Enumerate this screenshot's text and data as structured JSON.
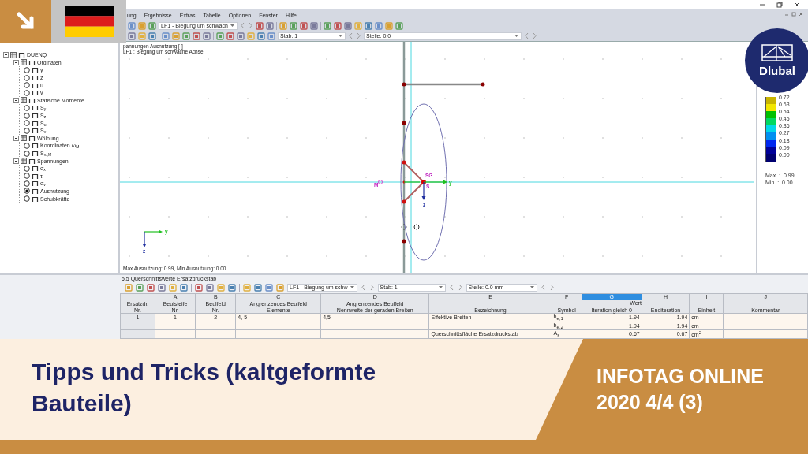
{
  "menu": [
    "ung",
    "Ergebnisse",
    "Extras",
    "Tabelle",
    "Optionen",
    "Fenster",
    "Hilfe"
  ],
  "toolbar": {
    "load_case": "LF1 - Biegung um schwach",
    "member": "Stab: 1",
    "location": "Stelle: 0.0"
  },
  "tree": {
    "label": "DUENQ",
    "expanded": true,
    "children": [
      {
        "label": "Ordinaten",
        "expanded": true,
        "children": [
          {
            "label": "y",
            "selected": false
          },
          {
            "label": "z",
            "selected": false
          },
          {
            "label": "u",
            "selected": false
          },
          {
            "label": "v",
            "selected": false
          }
        ]
      },
      {
        "label": "Statische Momente",
        "expanded": true,
        "children": [
          {
            "label": "S$_{y}$",
            "selected": false
          },
          {
            "label": "S$_{z}$",
            "selected": false
          },
          {
            "label": "S$_{u}$",
            "selected": false
          },
          {
            "label": "S$_{v}$",
            "selected": false
          }
        ]
      },
      {
        "label": "Wölbung",
        "expanded": true,
        "children": [
          {
            "label": "Koordinaten ω$_{M}$",
            "selected": false
          },
          {
            "label": "S$_{ω,M}$",
            "selected": false
          }
        ]
      },
      {
        "label": "Spannungen",
        "expanded": true,
        "children": [
          {
            "label": "σ$_{x}$",
            "selected": false
          },
          {
            "label": "τ",
            "selected": false
          },
          {
            "label": "σ$_{v}$",
            "selected": false
          },
          {
            "label": "Ausnutzung",
            "selected": true
          },
          {
            "label": "Schubkräfte",
            "selected": false
          }
        ]
      }
    ]
  },
  "canvas": {
    "title": "pannungen Ausnutzung [-]",
    "subtitle": "LF1 : Biegung um schwache Achse",
    "labels": [
      "SG",
      "S",
      "M",
      "y",
      "z",
      "y",
      "z"
    ],
    "footer": "Max Ausnutzung: 0.99, Min Ausnutzung: 0.00"
  },
  "legend": {
    "scale": [
      {
        "label": "0.72",
        "color": "#c8b400"
      },
      {
        "label": "0.63",
        "color": "#f2e600"
      },
      {
        "label": "0.54",
        "color": "#00c000"
      },
      {
        "label": "0.45",
        "color": "#00d860"
      },
      {
        "label": "0.36",
        "color": "#00d8e8"
      },
      {
        "label": "0.27",
        "color": "#0090f0"
      },
      {
        "label": "0.18",
        "color": "#0028f0"
      },
      {
        "label": "0.09",
        "color": "#000099"
      },
      {
        "label": "0.00",
        "color": "#000070"
      }
    ],
    "max": "Max  :  0.99",
    "min": "Min  :  0.00"
  },
  "table_panel": {
    "title": "5.5 Querschnittswerte Ersatzdruckstab",
    "load_case": "LF1 - Biegung um schw",
    "member": "Stab: 1",
    "location": "Stelle: 0.0 mm",
    "row_header": [
      "Ersatzdr.",
      "Nr."
    ],
    "group_heading": "Wert",
    "columns": [
      {
        "letter": "A",
        "heading": [
          "Beulsteife",
          "Nr."
        ],
        "selected": false
      },
      {
        "letter": "B",
        "heading": [
          "Beulfeld",
          "Nr."
        ],
        "selected": false
      },
      {
        "letter": "C",
        "heading": [
          "Angrenzendes Beulfeld",
          "Elemente"
        ],
        "selected": false
      },
      {
        "letter": "D",
        "heading": [
          "Angrenzendes Beulfeld",
          "Nennweite der geraden Breiten"
        ],
        "selected": false
      },
      {
        "letter": "E",
        "heading": [
          "Bezeichnung"
        ],
        "selected": false
      },
      {
        "letter": "F",
        "heading": [
          "Symbol"
        ],
        "selected": false
      },
      {
        "letter": "G",
        "heading": [
          "Iteration gleich 0"
        ],
        "selected": true
      },
      {
        "letter": "H",
        "heading": [
          "Enditeration"
        ],
        "selected": false
      },
      {
        "letter": "I",
        "heading": [
          "Einheit"
        ],
        "selected": false
      },
      {
        "letter": "J",
        "heading": [
          "Kommentar"
        ],
        "selected": false
      }
    ],
    "rows": [
      {
        "number": "1",
        "cells": {
          "A": "1",
          "B": "2",
          "C": "4, 5",
          "D": "4,5",
          "E": "Effektive Breiten",
          "F": "b$_{e,1}$",
          "G": "1.94",
          "H": "1.94",
          "I": "cm"
        }
      },
      {
        "cells": {
          "F": "b$_{e,2}$",
          "G": "1.94",
          "H": "1.94",
          "I": "cm"
        }
      },
      {
        "cells": {
          "E": "Querschnittsfläche Ersatzdruckstab",
          "F": "A$_{s}$",
          "G": "0.67",
          "H": "0.67",
          "I": "cm$^{2}$"
        }
      }
    ]
  },
  "banner": {
    "title": "Tipps und Tricks (kaltgeformte Bauteile)",
    "event": [
      "INFOTAG ONLINE",
      "2020 4/4 (3)"
    ],
    "logo": "Dlubal"
  }
}
